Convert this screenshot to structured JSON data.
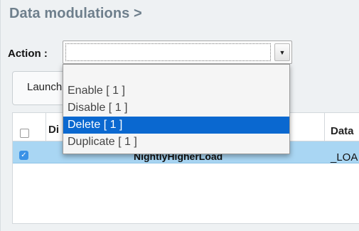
{
  "page": {
    "title": "Data modulations >"
  },
  "action": {
    "label": "Action :",
    "selected_value": "",
    "options": [
      "Enable [ 1 ]",
      "Disable [ 1 ]",
      "Delete [ 1 ]",
      "Duplicate [ 1 ]"
    ],
    "highlighted_option": "Delete [ 1 ]"
  },
  "toolbar": {
    "launch_label": "Launch"
  },
  "table": {
    "headers": [
      "Di",
      "Data"
    ],
    "rows": [
      {
        "checked": true,
        "name": "NightlyHigherLoad",
        "data": "_LOA"
      }
    ]
  },
  "colors": {
    "title": "#6e7f8c",
    "row_selected": "#a9d6f3",
    "option_highlight": "#0a68d0",
    "checkbox": "#3a92e6"
  }
}
